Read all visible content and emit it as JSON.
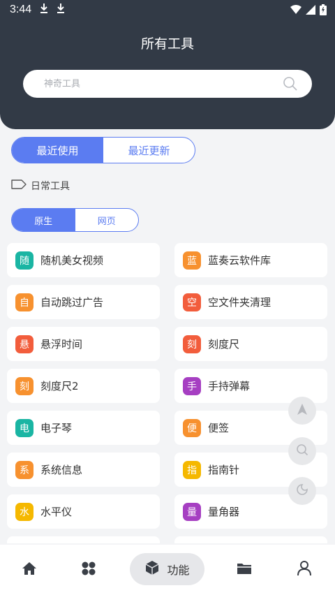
{
  "status_bar": {
    "time": "3:44"
  },
  "header": {
    "title": "所有工具"
  },
  "search": {
    "placeholder": "神奇工具"
  },
  "main_tabs": [
    {
      "label": "最近使用",
      "active": true
    },
    {
      "label": "最近更新",
      "active": false
    }
  ],
  "category": {
    "label": "日常工具"
  },
  "sub_tabs": [
    {
      "label": "原生",
      "active": true
    },
    {
      "label": "网页",
      "active": false
    }
  ],
  "tools": [
    {
      "badge": "随",
      "label": "随机美女视频",
      "color": "#1ab5a3"
    },
    {
      "badge": "蓝",
      "label": "蓝奏云软件库",
      "color": "#f7912f"
    },
    {
      "badge": "自",
      "label": "自动跳过广告",
      "color": "#f7912f"
    },
    {
      "badge": "空",
      "label": "空文件夹清理",
      "color": "#f25d3c"
    },
    {
      "badge": "悬",
      "label": "悬浮时间",
      "color": "#f25d3c"
    },
    {
      "badge": "刻",
      "label": "刻度尺",
      "color": "#f25d3c"
    },
    {
      "badge": "刻",
      "label": "刻度尺2",
      "color": "#f7912f"
    },
    {
      "badge": "手",
      "label": "手持弹幕",
      "color": "#a63fc2"
    },
    {
      "badge": "电",
      "label": "电子琴",
      "color": "#1ab5a3"
    },
    {
      "badge": "便",
      "label": "便签",
      "color": "#f7912f"
    },
    {
      "badge": "系",
      "label": "系统信息",
      "color": "#f7912f"
    },
    {
      "badge": "指",
      "label": "指南针",
      "color": "#f5b800"
    },
    {
      "badge": "水",
      "label": "水平仪",
      "color": "#f5b800"
    },
    {
      "badge": "量",
      "label": "量角器",
      "color": "#a63fc2"
    },
    {
      "badge": "",
      "label": "",
      "color": "#333333"
    },
    {
      "badge": "",
      "label": "",
      "color": "#f7912f"
    }
  ],
  "bottom_nav": {
    "active_label": "功能",
    "items": [
      "home-icon",
      "apps-icon",
      "cube-icon",
      "folder-icon",
      "user-icon"
    ]
  },
  "colors": {
    "header_bg": "#323a46",
    "accent": "#5b7cf1",
    "page_bg": "#f3f4f6"
  }
}
